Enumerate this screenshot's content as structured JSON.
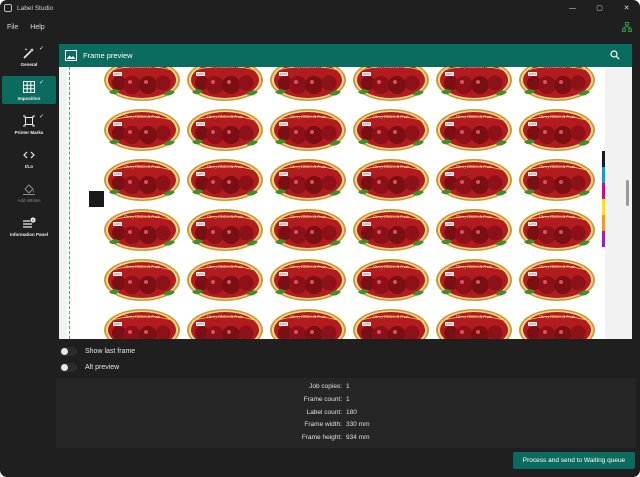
{
  "window": {
    "title": "Label Studio",
    "controls": [
      "—",
      "▢",
      "✕"
    ]
  },
  "menu": {
    "file": "File",
    "help": "Help"
  },
  "sidebar": {
    "items": [
      {
        "label": "General",
        "icon": "magic-wand-icon",
        "checked": true,
        "active": false,
        "disabled": false
      },
      {
        "label": "Imposition",
        "icon": "grid-icon",
        "checked": true,
        "active": true,
        "disabled": false
      },
      {
        "label": "Printer Marks",
        "icon": "crop-marks-icon",
        "checked": true,
        "active": false,
        "disabled": false
      },
      {
        "label": "I/Lo",
        "icon": "code-brackets-icon",
        "checked": false,
        "active": false,
        "disabled": false
      },
      {
        "label": "Add Whites",
        "icon": "paint-bucket-icon",
        "checked": false,
        "active": false,
        "disabled": true
      },
      {
        "label": "Information Panel",
        "icon": "info-list-icon",
        "checked": false,
        "active": false,
        "disabled": false
      }
    ]
  },
  "preview": {
    "title": "Frame preview",
    "label_text": "Cherry Choices & Fruits",
    "label_badge": "100%",
    "colors": {
      "accent": "#0b6b5e",
      "registration": "#1a1a1a",
      "cut_line": "#3cb24a",
      "color_bar": [
        "#1a1a1a",
        "#00a0e3",
        "#e4007c",
        "#ffe600",
        "#ff9900",
        "#a018c8"
      ]
    }
  },
  "options": {
    "show_last_frame": "Show last frame",
    "alt_preview": "Alt preview"
  },
  "info": {
    "rows": [
      {
        "key": "Job copies:",
        "value": "1"
      },
      {
        "key": "Frame count:",
        "value": "1"
      },
      {
        "key": "Label count:",
        "value": "180"
      },
      {
        "key": "Frame width:",
        "value": "330 mm"
      },
      {
        "key": "Frame height:",
        "value": "934 mm"
      }
    ]
  },
  "actions": {
    "process": "Process and send to Waiting queue"
  }
}
